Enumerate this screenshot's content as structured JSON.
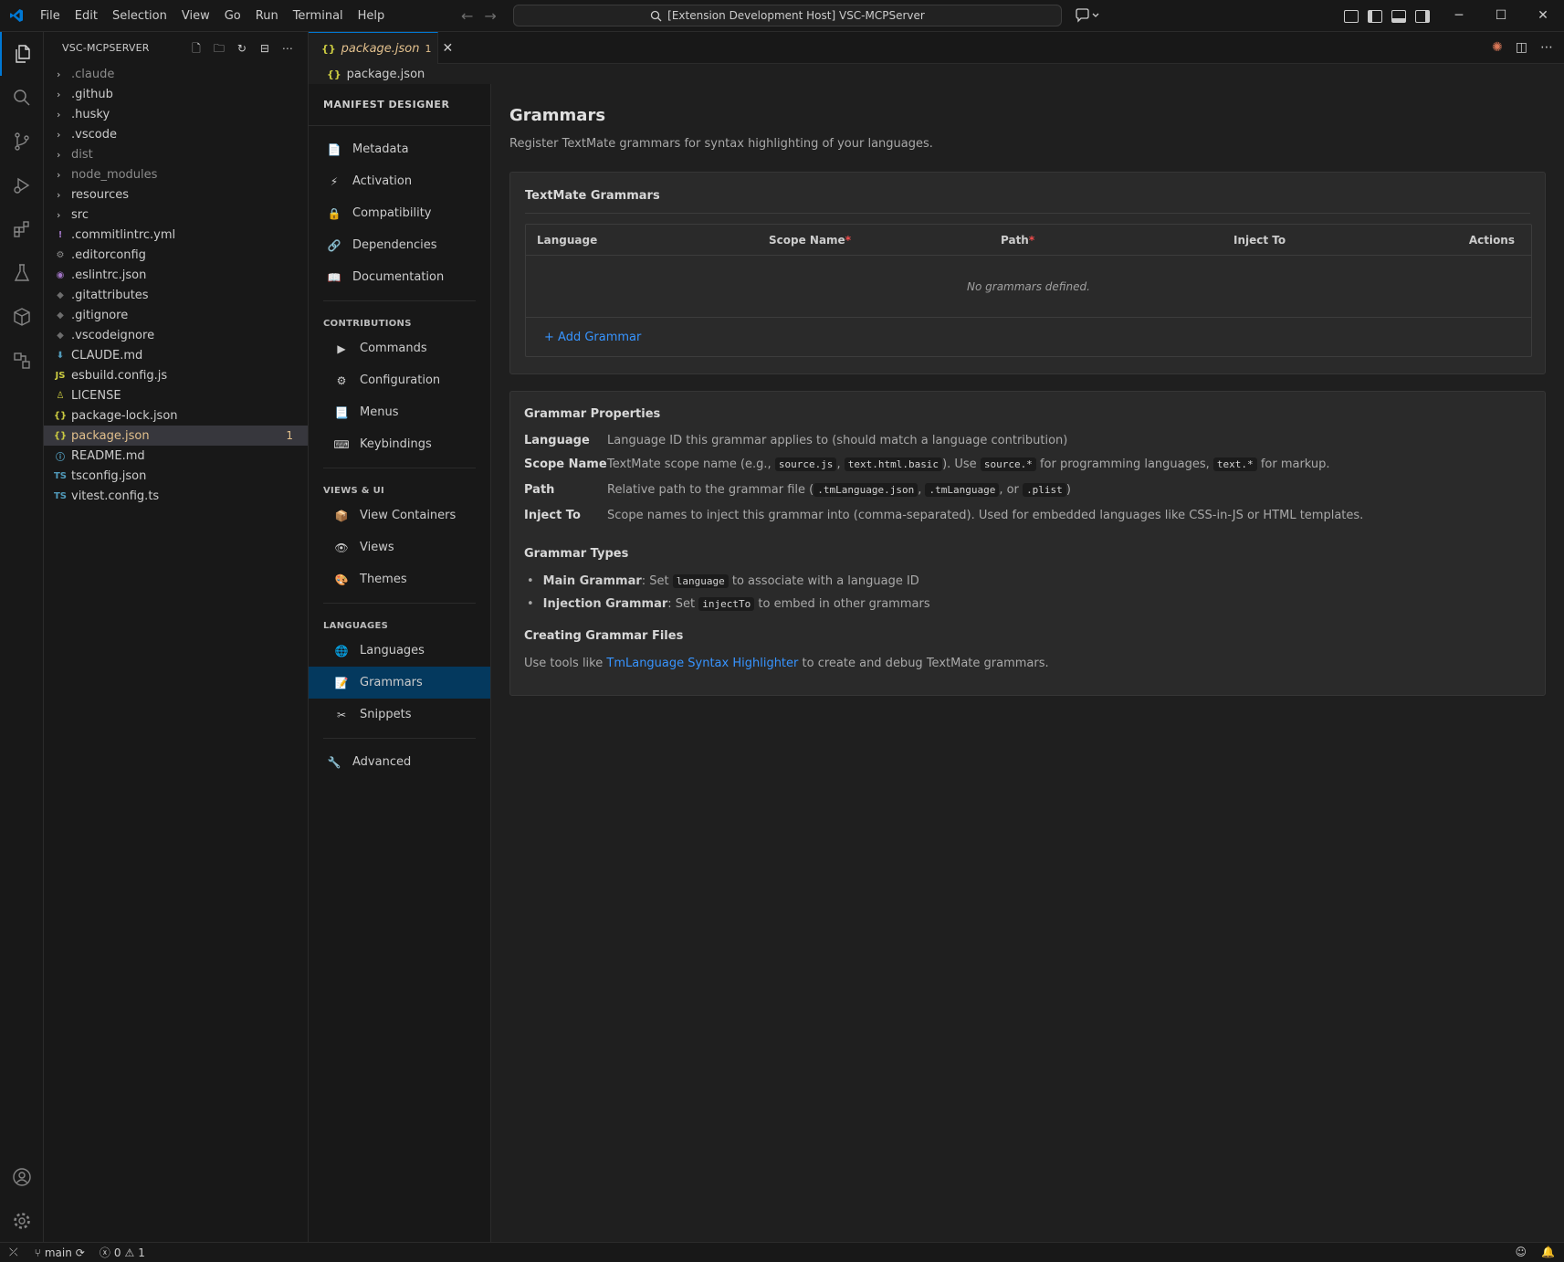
{
  "menu": [
    "File",
    "Edit",
    "Selection",
    "View",
    "Go",
    "Run",
    "Terminal",
    "Help"
  ],
  "search": {
    "text": "[Extension Development Host] VSC-MCPServer"
  },
  "explorer": {
    "title": "VSC-MCPSERVER",
    "items": [
      {
        "label": ".claude",
        "type": "folder",
        "dim": true
      },
      {
        "label": ".github",
        "type": "folder"
      },
      {
        "label": ".husky",
        "type": "folder"
      },
      {
        "label": ".vscode",
        "type": "folder"
      },
      {
        "label": "dist",
        "type": "folder",
        "dim": true
      },
      {
        "label": "node_modules",
        "type": "folder",
        "dim": true
      },
      {
        "label": "resources",
        "type": "folder"
      },
      {
        "label": "src",
        "type": "folder"
      },
      {
        "label": ".commitlintrc.yml",
        "type": "file",
        "icon": "!",
        "color": "#a074c4"
      },
      {
        "label": ".editorconfig",
        "type": "file",
        "icon": "⚙",
        "color": "#8c8c8c"
      },
      {
        "label": ".eslintrc.json",
        "type": "file",
        "icon": "◉",
        "color": "#a074c4"
      },
      {
        "label": ".gitattributes",
        "type": "file",
        "icon": "◆",
        "color": "#6d6d6d"
      },
      {
        "label": ".gitignore",
        "type": "file",
        "icon": "◆",
        "color": "#6d6d6d"
      },
      {
        "label": ".vscodeignore",
        "type": "file",
        "icon": "◆",
        "color": "#6d6d6d"
      },
      {
        "label": "CLAUDE.md",
        "type": "file",
        "icon": "⬇",
        "color": "#519aba"
      },
      {
        "label": "esbuild.config.js",
        "type": "file",
        "icon": "JS",
        "color": "#cbcb41"
      },
      {
        "label": "LICENSE",
        "type": "file",
        "icon": "♙",
        "color": "#cbcb41"
      },
      {
        "label": "package-lock.json",
        "type": "file",
        "icon": "{}",
        "color": "#cbcb41"
      },
      {
        "label": "package.json",
        "type": "file",
        "icon": "{}",
        "color": "#cbcb41",
        "selected": true,
        "badge": "1"
      },
      {
        "label": "README.md",
        "type": "file",
        "icon": "ⓘ",
        "color": "#519aba"
      },
      {
        "label": "tsconfig.json",
        "type": "file",
        "icon": "TS",
        "color": "#519aba"
      },
      {
        "label": "vitest.config.ts",
        "type": "file",
        "icon": "TS",
        "color": "#519aba"
      }
    ]
  },
  "tab": {
    "label": "package.json",
    "badge": "1",
    "icon": "{}"
  },
  "breadcrumb": {
    "label": "package.json",
    "icon": "{}"
  },
  "designer": {
    "title": "MANIFEST DESIGNER",
    "top_items": [
      {
        "label": "Metadata",
        "icon": "📄"
      },
      {
        "label": "Activation",
        "icon": "⚡"
      },
      {
        "label": "Compatibility",
        "icon": "🔒"
      },
      {
        "label": "Dependencies",
        "icon": "🔗"
      },
      {
        "label": "Documentation",
        "icon": "📖"
      }
    ],
    "contributions_label": "CONTRIBUTIONS",
    "contributions": [
      {
        "label": "Commands",
        "icon": "▶"
      },
      {
        "label": "Configuration",
        "icon": "⚙"
      },
      {
        "label": "Menus",
        "icon": "📃"
      },
      {
        "label": "Keybindings",
        "icon": "⌨"
      }
    ],
    "views_label": "VIEWS & UI",
    "views": [
      {
        "label": "View Containers",
        "icon": "📦"
      },
      {
        "label": "Views",
        "icon": "👁"
      },
      {
        "label": "Themes",
        "icon": "🎨"
      }
    ],
    "languages_label": "LANGUAGES",
    "languages": [
      {
        "label": "Languages",
        "icon": "🌐"
      },
      {
        "label": "Grammars",
        "icon": "📝",
        "active": true
      },
      {
        "label": "Snippets",
        "icon": "✂"
      }
    ],
    "advanced": {
      "label": "Advanced",
      "icon": "🔧"
    }
  },
  "main": {
    "title": "Grammars",
    "subtitle": "Register TextMate grammars for syntax highlighting of your languages.",
    "table_panel_title": "TextMate Grammars",
    "columns": {
      "language": "Language",
      "scope": "Scope Name",
      "path": "Path",
      "inject": "Inject To",
      "actions": "Actions",
      "required": "*"
    },
    "empty": "No grammars defined.",
    "add_button": "+ Add Grammar",
    "props_title": "Grammar Properties",
    "props": {
      "language_key": "Language",
      "language_val": "Language ID this grammar applies to (should match a language contribution)",
      "scope_key": "Scope Name",
      "scope_pre": "TextMate scope name (e.g.,",
      "scope_code1": "source.js",
      "scope_sep": ",",
      "scope_code2": "text.html.basic",
      "scope_mid": "). Use",
      "scope_code3": "source.*",
      "scope_mid2": "for programming languages,",
      "scope_code4": "text.*",
      "scope_post": "for markup.",
      "path_key": "Path",
      "path_pre": "Relative path to the grammar file (",
      "path_code1": ".tmLanguage.json",
      "path_sep": ",",
      "path_code2": ".tmLanguage",
      "path_or": ", or",
      "path_code3": ".plist",
      "path_post": ")",
      "inject_key": "Inject To",
      "inject_val": "Scope names to inject this grammar into (comma-separated). Used for embedded languages like CSS-in-JS or HTML templates."
    },
    "types_title": "Grammar Types",
    "types": {
      "main_label": "Main Grammar",
      "main_pre": ": Set",
      "main_code": "language",
      "main_post": "to associate with a language ID",
      "inj_label": "Injection Grammar",
      "inj_pre": ": Set",
      "inj_code": "injectTo",
      "inj_post": "to embed in other grammars"
    },
    "creating_title": "Creating Grammar Files",
    "creating_pre": "Use tools like",
    "creating_link": "TmLanguage Syntax Highlighter",
    "creating_post": "to create and debug TextMate grammars."
  },
  "status": {
    "branch": "main",
    "errors": "0",
    "warnings": "1"
  }
}
